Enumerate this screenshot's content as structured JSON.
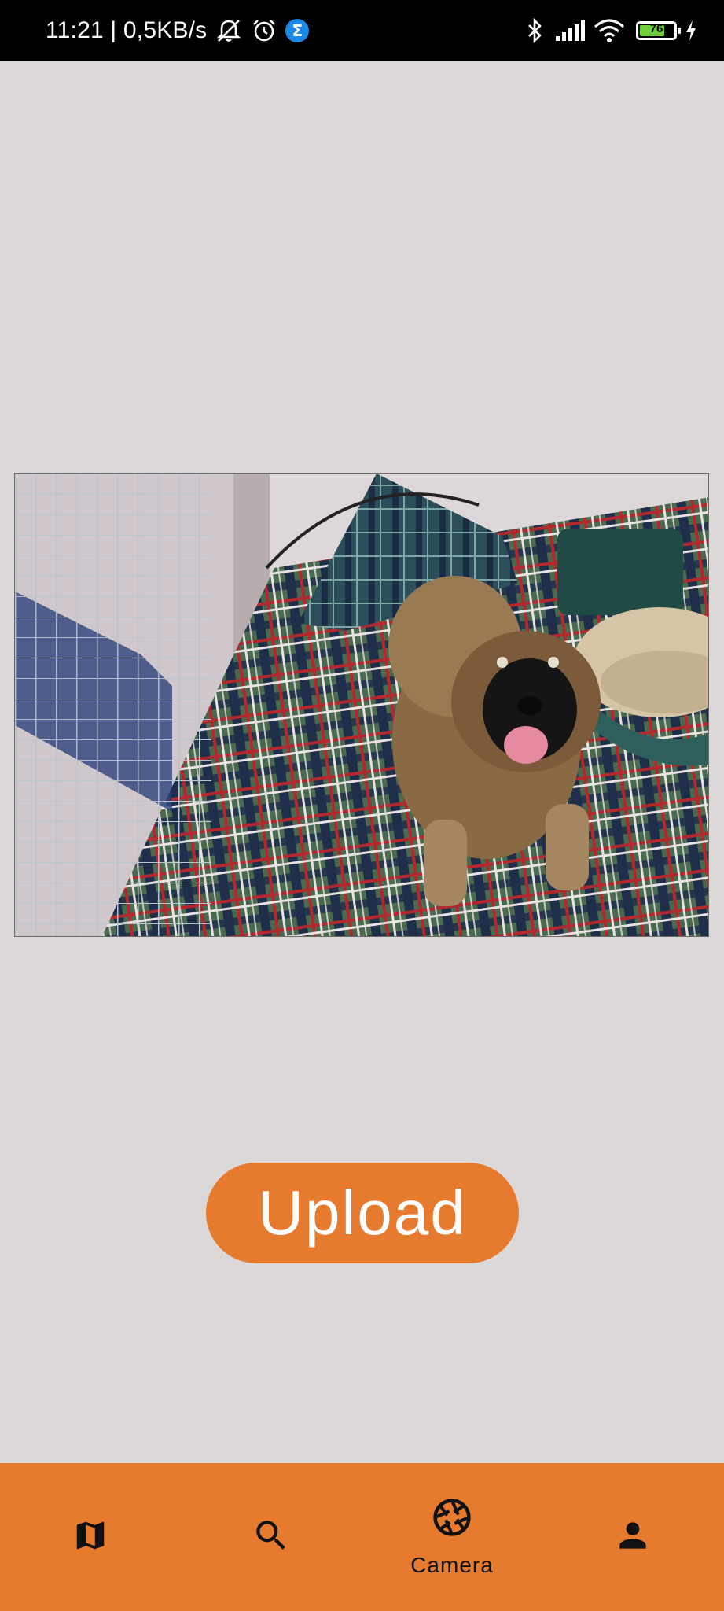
{
  "status_bar": {
    "time_speed": "11:21 | 0,5KB/s",
    "sigma_badge": "Σ",
    "battery_level": 76,
    "battery_text": "76"
  },
  "main": {
    "upload_label": "Upload"
  },
  "bottom_nav": {
    "items": [
      {
        "icon": "map-icon",
        "label": ""
      },
      {
        "icon": "search-icon",
        "label": ""
      },
      {
        "icon": "camera-aperture-icon",
        "label": "Camera"
      },
      {
        "icon": "person-icon",
        "label": ""
      }
    ],
    "selected_index": 2
  },
  "colors": {
    "accent": "#e67a2e",
    "background": "#dcd8d8",
    "status_bar": "#000000"
  }
}
